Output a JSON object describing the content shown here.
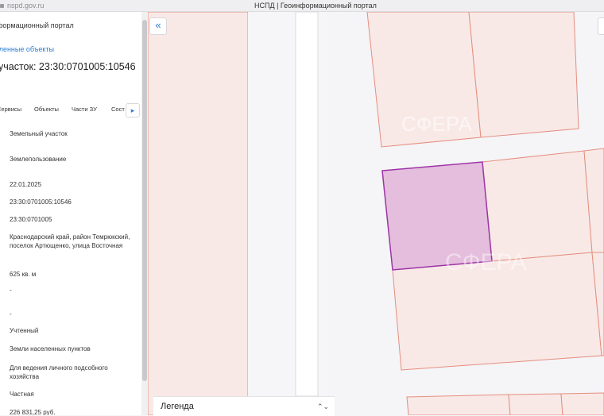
{
  "browser": {
    "url": "nspd.gov.ru",
    "title": "НСПД | Геоинформационный портал"
  },
  "panel": {
    "portal_title": "формационный портал",
    "link": "еленные объекты",
    "heading": "участок: 23:30:0701005:10546",
    "tabs": [
      "Сервисы",
      "Объекты",
      "Части ЗУ",
      "Сост"
    ],
    "tab_more": "▸",
    "rows": [
      "Земельный участок",
      "Землепользование",
      "22.01.2025",
      "23:30:0701005:10546",
      "23:30:0701005",
      "Краснодарский край, район Темрюкский, поселок Артющенко, улица Восточная",
      "625 кв. м",
      "-",
      "-",
      "Учтенный",
      "Земли населенных пунктов",
      "Для ведения личного подсобного хозяйства",
      "Частная",
      "226 831,25 руб."
    ]
  },
  "map": {
    "collapse_icon": "«",
    "watermark": "СФЕРА"
  },
  "legend": {
    "label": "Легенда",
    "toggle": "⌃⌄"
  },
  "colors": {
    "parcel_stroke": "#e58f7f",
    "parcel_fill": "#f8e9e7",
    "selected_stroke": "#9c34a6",
    "selected_fill": "#e5bddd",
    "link": "#2e7fd0"
  }
}
